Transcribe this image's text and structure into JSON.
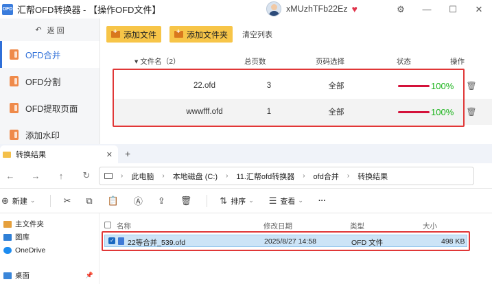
{
  "app": {
    "logo_text": "OFD",
    "title": "汇帮OFD转换器 - 【操作OFD文件】",
    "username": "xMUzhTFb22Ez",
    "controls": {
      "settings": "⚙",
      "minimize": "—",
      "maximize": "☐",
      "close": "✕"
    }
  },
  "sidebar": {
    "back": {
      "icon": "↶",
      "label": "返 回"
    },
    "items": [
      {
        "label": "OFD合并",
        "active": true
      },
      {
        "label": "OFD分割",
        "active": false
      },
      {
        "label": "OFD提取页面",
        "active": false
      },
      {
        "label": "添加水印",
        "active": false
      }
    ]
  },
  "toolbar": {
    "add_file": "添加文件",
    "add_folder": "添加文件夹",
    "clear_list": "清空列表"
  },
  "table": {
    "headers": {
      "name": "▾ 文件名（2）",
      "pages": "总页数",
      "range": "页码选择",
      "status": "状态",
      "op": "操作"
    },
    "rows": [
      {
        "name": "22.ofd",
        "pages": "3",
        "range": "全部",
        "progress_pct": 100,
        "status": "100%"
      },
      {
        "name": "wwwfff.ofd",
        "pages": "1",
        "range": "全部",
        "progress_pct": 100,
        "status": "100%"
      }
    ],
    "delete_icon": "🗑"
  },
  "explorer": {
    "tab_title": "转换结果",
    "tab_close": "✕",
    "tab_add": "+",
    "nav": {
      "back": "←",
      "forward": "→",
      "up": "↑",
      "refresh": "↻"
    },
    "breadcrumbs": [
      "此电脑",
      "本地磁盘 (C:)",
      "11.汇帮ofd转换器",
      "ofd合并",
      "转换结果"
    ],
    "commands": {
      "new": "新建",
      "sort": "排序",
      "view": "查看",
      "more": "···"
    },
    "nav_pane": [
      {
        "label": "主文件夹",
        "color": "#e6a03c"
      },
      {
        "label": "图库",
        "color": "#2f7fd6"
      },
      {
        "label": "OneDrive",
        "color": "#1d8cf0"
      },
      {
        "label": "桌面",
        "color": "#3a86d9"
      }
    ],
    "columns": {
      "name": "名称",
      "modified": "修改日期",
      "type": "类型",
      "size": "大小"
    },
    "files": [
      {
        "name": "22等合并_539.ofd",
        "modified": "2025/8/27 14:58",
        "type": "OFD 文件",
        "size": "498 KB"
      }
    ]
  },
  "colors": {
    "accent": "#2f6fd8",
    "button_yellow": "#f7c548",
    "progress_red": "#d4123a",
    "success_green": "#18b318",
    "highlight_box": "#e03737"
  }
}
